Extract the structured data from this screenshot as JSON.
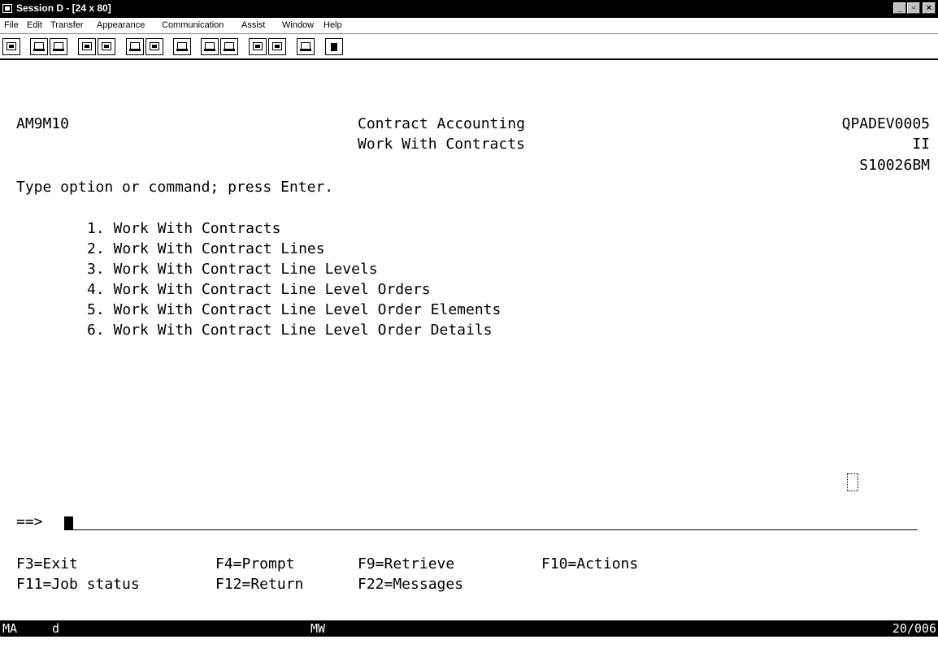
{
  "window": {
    "title": "Session D - [24 x 80]",
    "buttons": [
      "_",
      "▫",
      "×"
    ]
  },
  "menu": [
    "File",
    "Edit",
    "Transfer",
    "Appearance",
    "Communication",
    "Assist",
    "Window",
    "Help"
  ],
  "toolbar_icons": [
    "print-screen-icon",
    "copy-icon",
    "paste-icon",
    "send-icon",
    "receive-icon",
    "macro-play-icon",
    "macro-record-icon",
    "chart-icon",
    "record-start-icon",
    "record-stop-icon",
    "transfer-up-icon",
    "transfer-down-icon",
    "clipboard-icon",
    "stop-icon"
  ],
  "screen": {
    "program_id": "AM9M10",
    "title": "Contract Accounting",
    "subtitle": "Work With Contracts",
    "device": "QPADEV0005",
    "env": "II",
    "system": "S10026BM",
    "instruction": "Type option or command; press Enter.",
    "options": [
      "1. Work With Contracts",
      "2. Work With Contract Lines",
      "3. Work With Contract Line Levels",
      "4. Work With Contract Line Level Orders",
      "5. Work With Contract Line Level Order Elements",
      "6. Work With Contract Line Level Order Details"
    ],
    "prompt": "==>",
    "command_value": "",
    "fkeys_row1": [
      "F3=Exit",
      "F4=Prompt",
      "F9=Retrieve",
      "F10=Actions"
    ],
    "fkeys_row2": [
      "F11=Job status",
      "F12=Return",
      "F22=Messages"
    ]
  },
  "status": {
    "mode": "MA",
    "session": "d",
    "indicator": "MW",
    "position": "20/006"
  }
}
